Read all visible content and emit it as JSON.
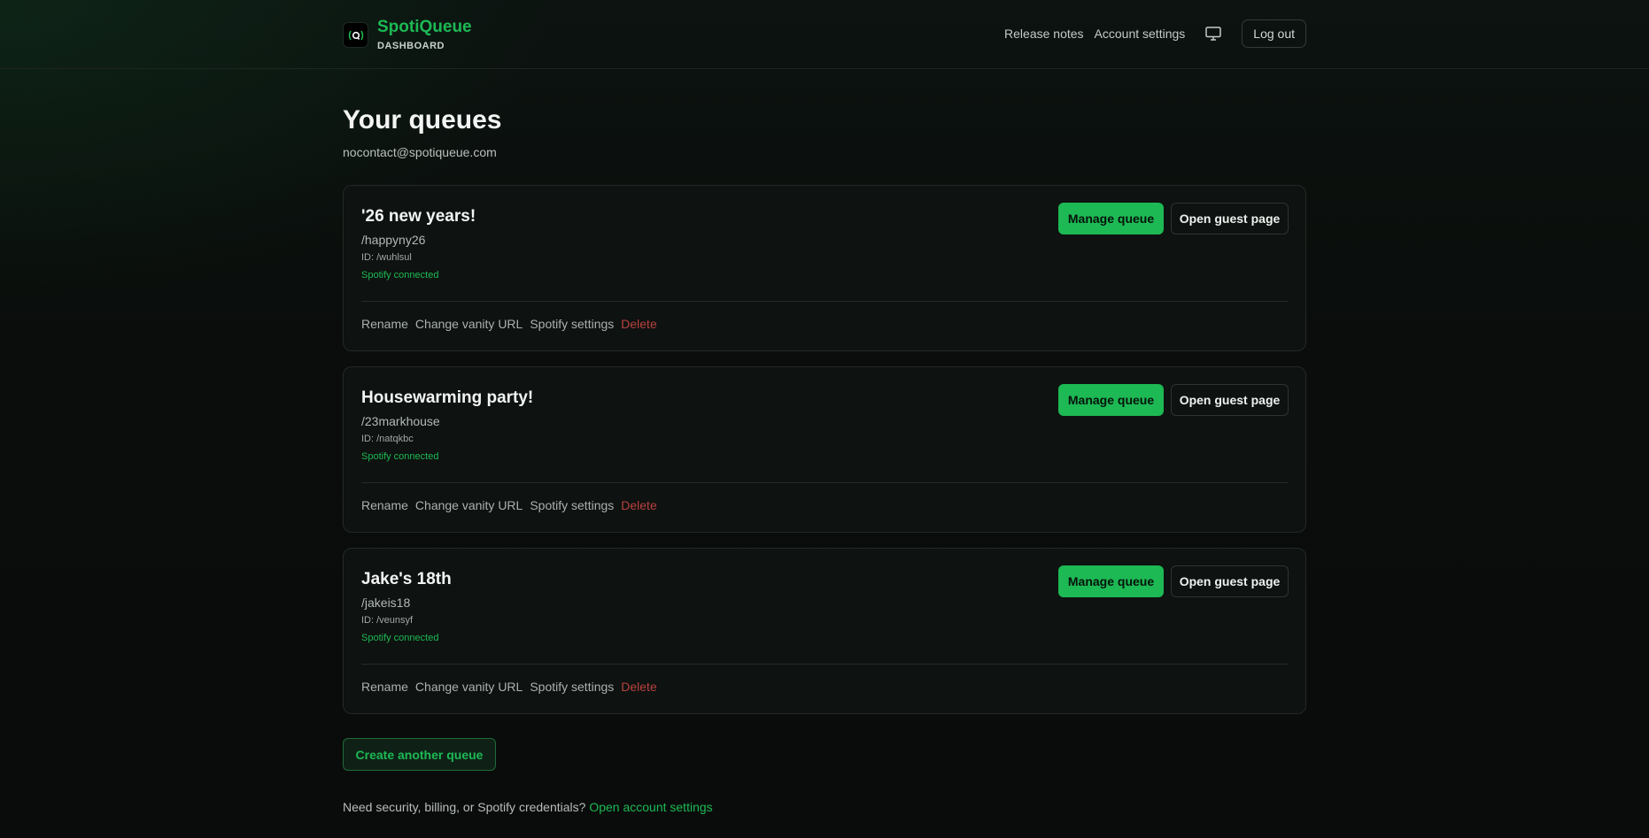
{
  "header": {
    "brand_name": "SpotiQueue",
    "brand_subtitle": "DASHBOARD",
    "logo_icon": "queue-logo-icon",
    "nav": {
      "release_notes": "Release notes",
      "account_settings": "Account settings",
      "monitor_icon": "monitor-icon",
      "logout": "Log out"
    }
  },
  "page": {
    "title": "Your queues",
    "email": "nocontact@spotiqueue.com"
  },
  "queues": [
    {
      "name": "'26 new years!",
      "vanity": "/happyny26",
      "id": "ID: /wuhlsul",
      "status": "Spotify connected",
      "manage_label": "Manage queue",
      "guest_label": "Open guest page",
      "actions": {
        "rename": "Rename",
        "vanity": "Change vanity URL",
        "spotify": "Spotify settings",
        "delete": "Delete"
      }
    },
    {
      "name": "Housewarming party!",
      "vanity": "/23markhouse",
      "id": "ID: /natqkbc",
      "status": "Spotify connected",
      "manage_label": "Manage queue",
      "guest_label": "Open guest page",
      "actions": {
        "rename": "Rename",
        "vanity": "Change vanity URL",
        "spotify": "Spotify settings",
        "delete": "Delete"
      }
    },
    {
      "name": "Jake's 18th",
      "vanity": "/jakeis18",
      "id": "ID: /veunsyf",
      "status": "Spotify connected",
      "manage_label": "Manage queue",
      "guest_label": "Open guest page",
      "actions": {
        "rename": "Rename",
        "vanity": "Change vanity URL",
        "spotify": "Spotify settings",
        "delete": "Delete"
      }
    }
  ],
  "create_button": "Create another queue",
  "footer": {
    "text": "Need security, billing, or Spotify credentials?",
    "link": "Open account settings"
  },
  "colors": {
    "accent": "#1db954",
    "danger": "#b8423f",
    "background": "#0a0e0c",
    "card": "#0e1210"
  }
}
